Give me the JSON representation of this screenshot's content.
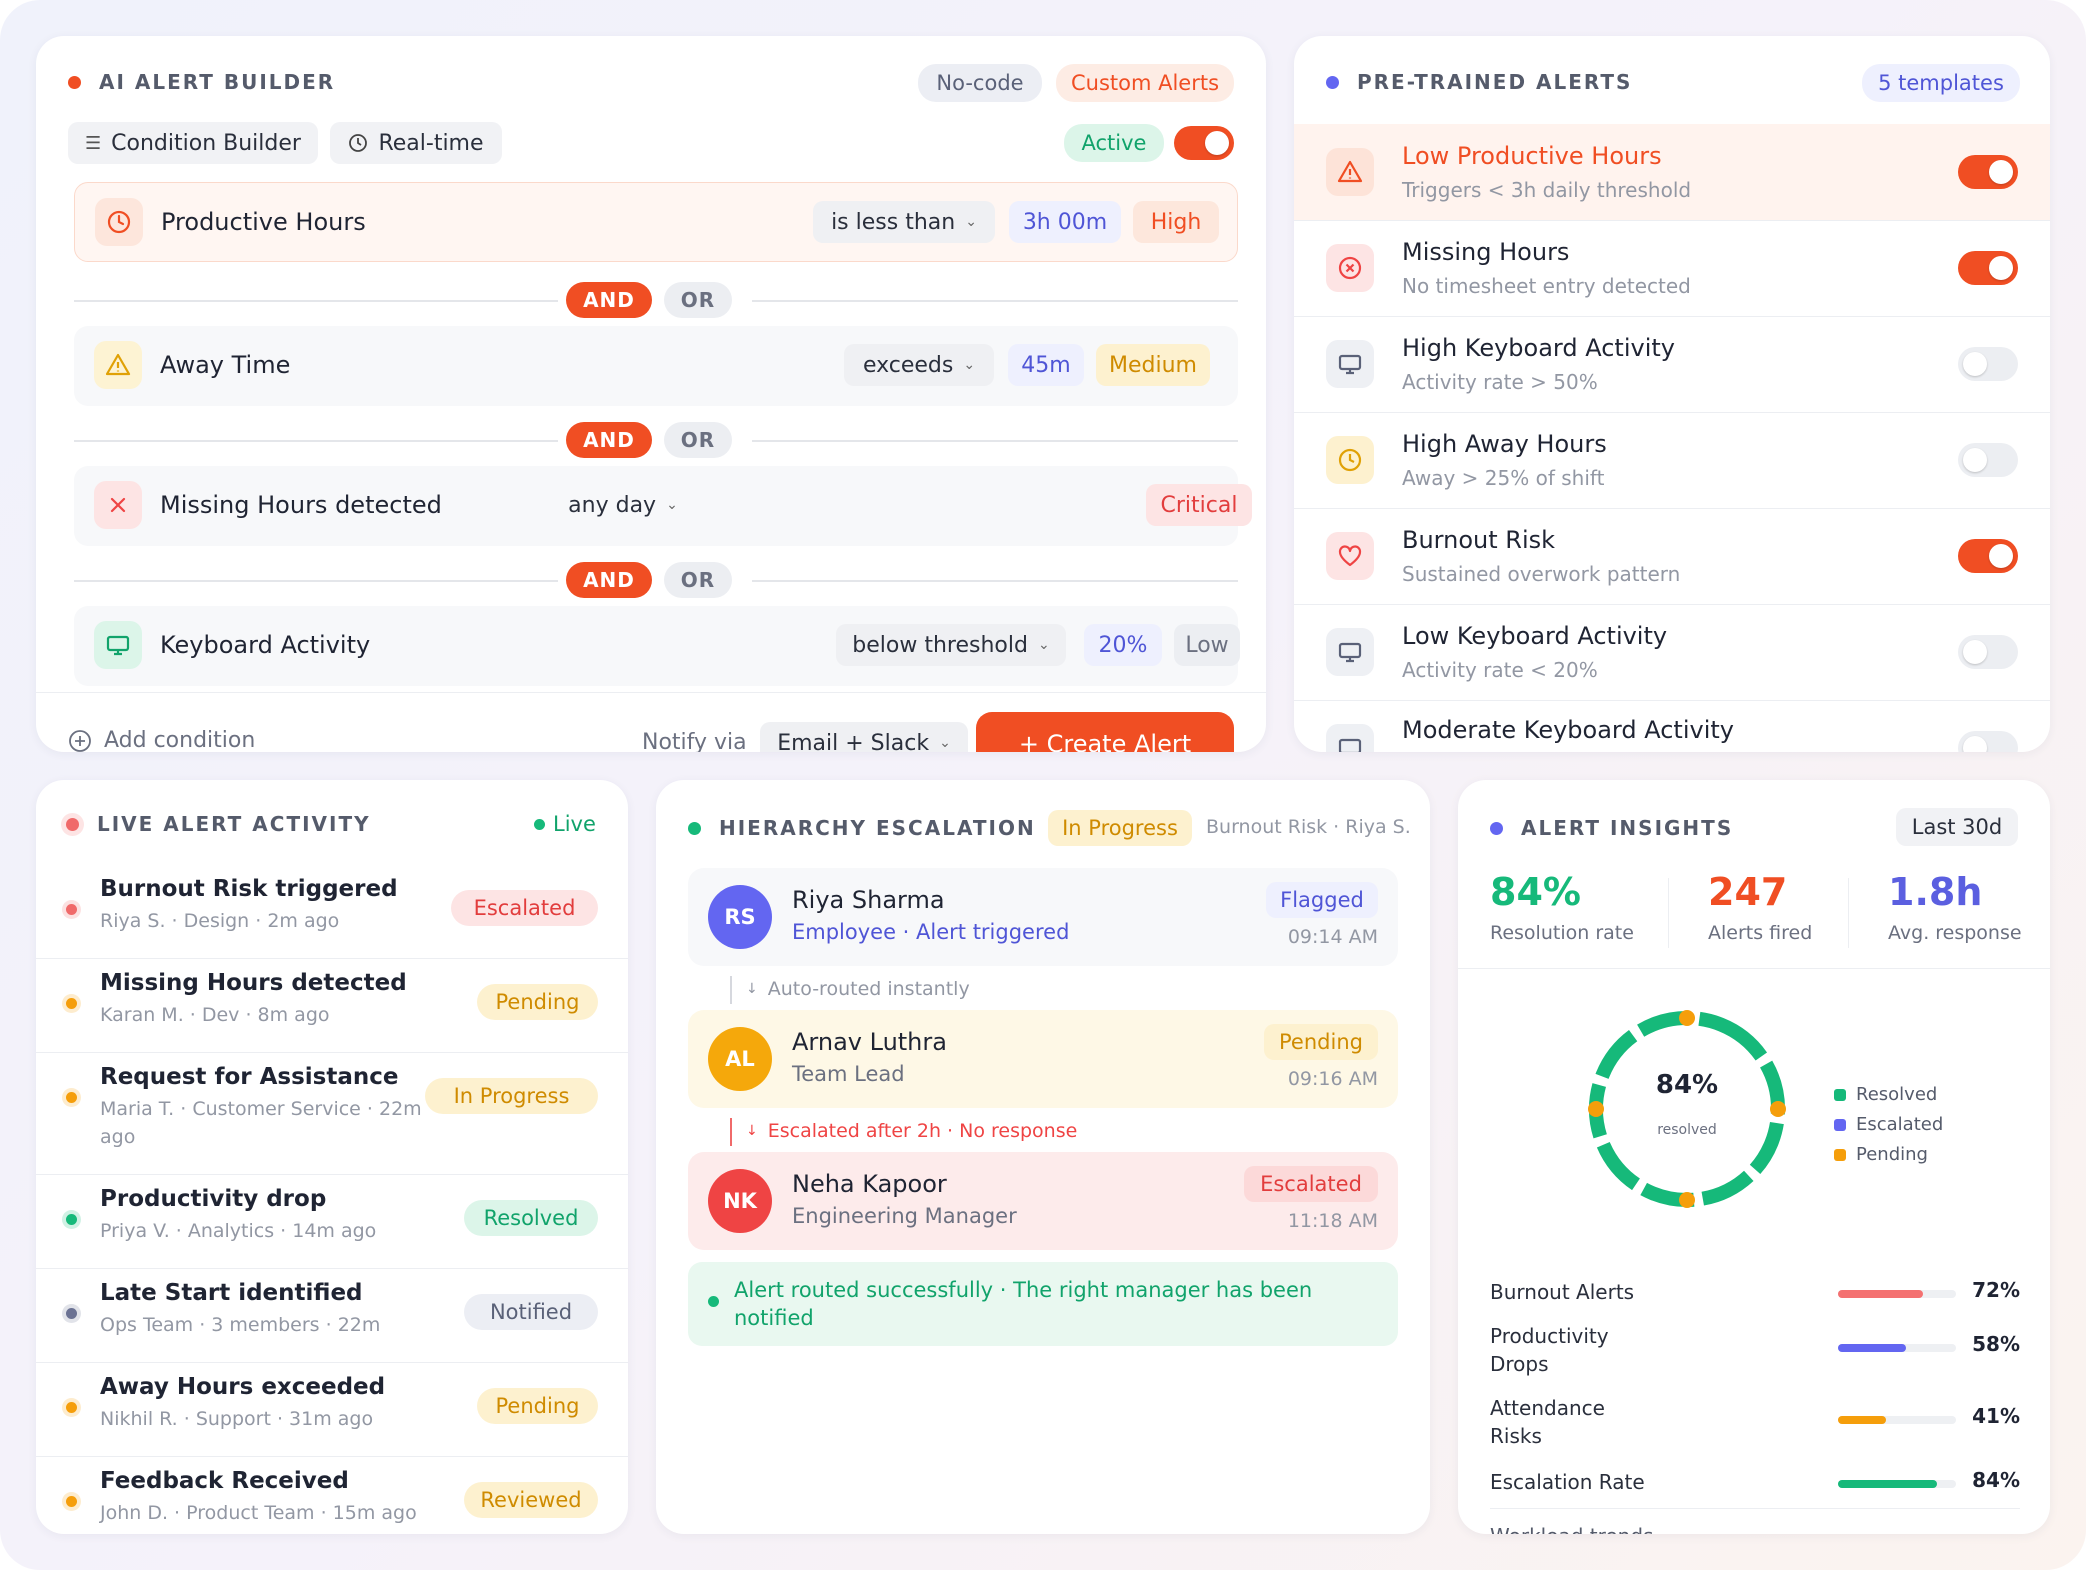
{
  "builder": {
    "title": "AI ALERT BUILDER",
    "badge_nocode": "No-code",
    "badge_custom": "Custom Alerts",
    "tab_condition": "Condition Builder",
    "tab_realtime": "Real-time",
    "status": "Active",
    "active_on": true,
    "and_label": "AND",
    "or_label": "OR",
    "conditions": [
      {
        "label": "Productive Hours",
        "operator": "is less than",
        "value": "3h 00m",
        "severity": "High",
        "icon": "clock-icon"
      },
      {
        "label": "Away Time",
        "operator": "exceeds",
        "value": "45m",
        "severity": "Medium",
        "icon": "warning-icon"
      },
      {
        "label": "Missing Hours detected",
        "operator": "any day",
        "value": "",
        "severity": "Critical",
        "icon": "x-icon"
      },
      {
        "label": "Keyboard Activity",
        "operator": "below threshold",
        "value": "20%",
        "severity": "Low",
        "icon": "monitor-icon"
      }
    ],
    "add_condition": "Add condition",
    "notify_label": "Notify via",
    "notify_value": "Email + Slack",
    "create_button": "+ Create Alert"
  },
  "pretrained": {
    "title": "PRE-TRAINED ALERTS",
    "count": "5 templates",
    "items": [
      {
        "name": "Low Productive Hours",
        "desc": "Triggers < 3h daily threshold",
        "enabled": true,
        "icon": "warning-icon"
      },
      {
        "name": "Missing Hours",
        "desc": "No timesheet entry detected",
        "enabled": true,
        "icon": "x-circle-icon"
      },
      {
        "name": "High Keyboard Activity",
        "desc": "Activity rate > 50%",
        "enabled": false,
        "icon": "monitor-icon"
      },
      {
        "name": "High Away Hours",
        "desc": "Away > 25% of shift",
        "enabled": false,
        "icon": "clock-icon"
      },
      {
        "name": "Burnout Risk",
        "desc": "Sustained overwork pattern",
        "enabled": true,
        "icon": "heart-icon"
      },
      {
        "name": "Low Keyboard Activity",
        "desc": "Activity rate < 20%",
        "enabled": false,
        "icon": "monitor-icon"
      },
      {
        "name": "Moderate Keyboard Activity",
        "desc": "",
        "enabled": false,
        "icon": "monitor-icon"
      }
    ]
  },
  "live": {
    "title": "LIVE ALERT ACTIVITY",
    "status": "Live",
    "items": [
      {
        "title": "Burnout Risk triggered",
        "meta": "Riya S. · Design · 2m ago",
        "status": "Escalated",
        "color": "#f06a6a"
      },
      {
        "title": "Missing Hours detected",
        "meta": "Karan M. · Dev · 8m ago",
        "status": "Pending",
        "color": "#f59e0b"
      },
      {
        "title": "Request for Assistance",
        "meta": "Maria T. · Customer Service · 22m",
        "meta2": "ago",
        "status": "In Progress",
        "color": "#f59e0b"
      },
      {
        "title": "Productivity drop",
        "meta": "Priya V. · Analytics · 14m ago",
        "status": "Resolved",
        "color": "#16b97a"
      },
      {
        "title": "Late Start identified",
        "meta": "Ops Team · 3 members · 22m",
        "status": "Notified",
        "color": "#6b7293"
      },
      {
        "title": "Away Hours exceeded",
        "meta": "Nikhil R. · Support · 31m ago",
        "status": "Pending",
        "color": "#f59e0b"
      },
      {
        "title": "Feedback Received",
        "meta": "John D. · Product Team · 15m ago",
        "status": "Reviewed",
        "color": "#f59e0b"
      }
    ]
  },
  "escalation": {
    "title": "HIERARCHY ESCALATION",
    "status": "In Progress",
    "context": "Burnout Risk · Riya S.",
    "people": [
      {
        "initials": "RS",
        "name": "Riya Sharma",
        "role": "Employee · Alert triggered",
        "status": "Flagged",
        "time": "09:14 AM"
      },
      {
        "initials": "AL",
        "name": "Arnav Luthra",
        "role": "Team Lead",
        "status": "Pending",
        "time": "09:16 AM"
      },
      {
        "initials": "NK",
        "name": "Neha Kapoor",
        "role": "Engineering Manager",
        "status": "Escalated",
        "time": "11:18 AM"
      }
    ],
    "step1": "Auto-routed instantly",
    "step2": "Escalated after 2h · No response",
    "success": "Alert routed successfully · The right manager has been notified"
  },
  "insights": {
    "title": "ALERT INSIGHTS",
    "period": "Last 30d",
    "stats": [
      {
        "value": "84%",
        "label": "Resolution rate",
        "color": "#16b97a"
      },
      {
        "value": "247",
        "label": "Alerts fired",
        "color": "#f04e23"
      },
      {
        "value": "1.8h",
        "label": "Avg. response",
        "color": "#5b5fe0"
      }
    ],
    "donut_value": "84%",
    "donut_label": "resolved",
    "legend": [
      "Resolved",
      "Escalated",
      "Pending"
    ],
    "bars": [
      {
        "label": "Burnout Alerts",
        "value": 72,
        "display": "72%",
        "color": "#f47171"
      },
      {
        "label": "Productivity Drops",
        "value": 58,
        "display": "58%",
        "color": "#6366f1"
      },
      {
        "label": "Attendance Risks",
        "value": 41,
        "display": "41%",
        "color": "#f59e0b"
      },
      {
        "label": "Escalation Rate",
        "value": 84,
        "display": "84%",
        "color": "#16b97a"
      }
    ],
    "cut_label": "Workload trends"
  }
}
